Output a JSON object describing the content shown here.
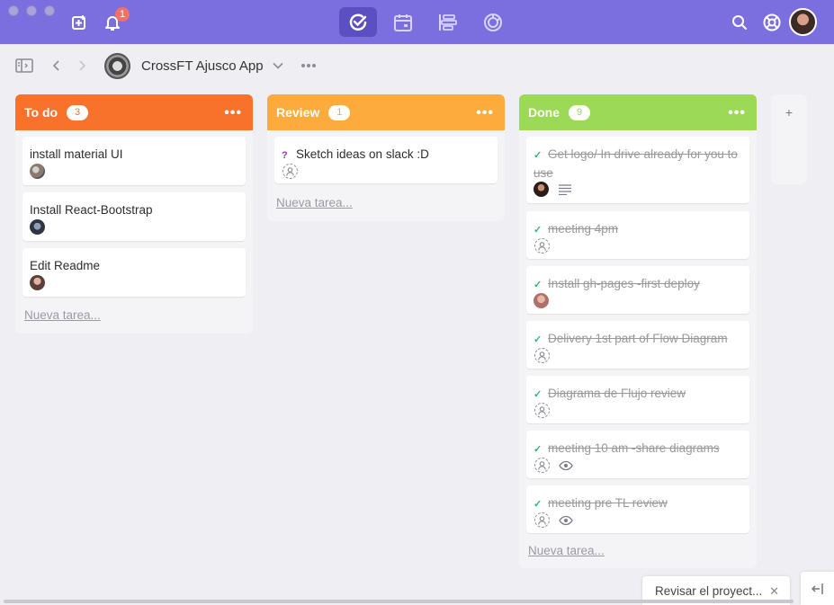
{
  "topbar": {
    "notification_count": "1",
    "colors": {
      "bar": "#7b6fe0",
      "active": "#5b4fc2"
    },
    "icons": [
      "new-task-icon",
      "bell-icon",
      "home-tasks-icon",
      "calendar-icon",
      "timeline-icon",
      "dashboard-icon",
      "search-icon",
      "help-lifebuoy-icon",
      "user-avatar"
    ]
  },
  "subheader": {
    "project_name": "CrossFT Ajusco App"
  },
  "columns": [
    {
      "title": "To do",
      "count": "3",
      "color": "#f8722c",
      "cards": [
        {
          "title": "install material UI"
        },
        {
          "title": "Install React-Bootstrap"
        },
        {
          "title": "Edit Readme"
        }
      ],
      "new_task": "Nueva tarea..."
    },
    {
      "title": "Review",
      "count": "1",
      "color": "#fdab3d",
      "cards": [
        {
          "mark": "?",
          "title": "Sketch ideas on slack :D"
        }
      ],
      "new_task": "Nueva tarea..."
    },
    {
      "title": "Done",
      "count": "9",
      "color": "#9cd956",
      "cards": [
        {
          "mark": "✓",
          "title": "Get logo/ In drive already for you to use"
        },
        {
          "mark": "✓",
          "title": "meeting 4pm"
        },
        {
          "mark": "✓",
          "title": "Install gh-pages -first deploy"
        },
        {
          "mark": "✓",
          "title": "Delivery 1st part of Flow Diagram"
        },
        {
          "mark": "✓",
          "title": "Diagrama de Flujo review"
        },
        {
          "mark": "✓",
          "title": "meeting 10 am -share diagrams"
        },
        {
          "mark": "✓",
          "title": "meeting pre TL review"
        }
      ],
      "new_task": "Nueva tarea..."
    }
  ],
  "add_column_label": "+",
  "toast": {
    "label": "Revisar el proyect..."
  }
}
